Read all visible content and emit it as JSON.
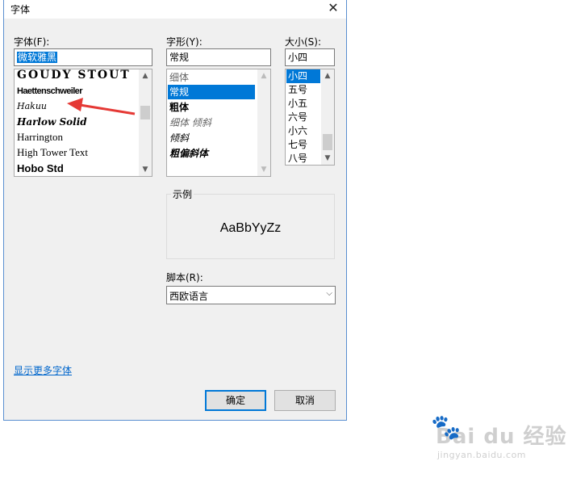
{
  "dialog": {
    "title": "字体",
    "close_glyph": "✕"
  },
  "font": {
    "label": "字体(F):",
    "input_value": "微软雅黑",
    "items": [
      "GOUDY STOUT",
      "Haettenschweiler",
      "Hakuu",
      "Harlow Solid",
      "Harrington",
      "High Tower Text",
      "Hobo Std"
    ]
  },
  "style": {
    "label": "字形(Y):",
    "input_value": "常规",
    "items": [
      "细体",
      "常规",
      "粗体",
      "细体 倾斜",
      "倾斜",
      "粗偏斜体"
    ],
    "selected": "常规"
  },
  "size": {
    "label": "大小(S):",
    "input_value": "小四",
    "items": [
      "小四",
      "五号",
      "小五",
      "六号",
      "小六",
      "七号",
      "八号"
    ],
    "selected": "小四"
  },
  "preview": {
    "label": "示例",
    "text": "AaBbYyZz"
  },
  "script": {
    "label": "脚本(R):",
    "value": "西欧语言"
  },
  "more_fonts_link": "显示更多字体",
  "buttons": {
    "ok": "确定",
    "cancel": "取消"
  },
  "watermark": {
    "main": "Bai du 经验",
    "sub": "jingyan.baidu.com"
  },
  "colors": {
    "selection": "#0078d7",
    "annotation_arrow": "#e53935",
    "link": "#0066cc"
  }
}
